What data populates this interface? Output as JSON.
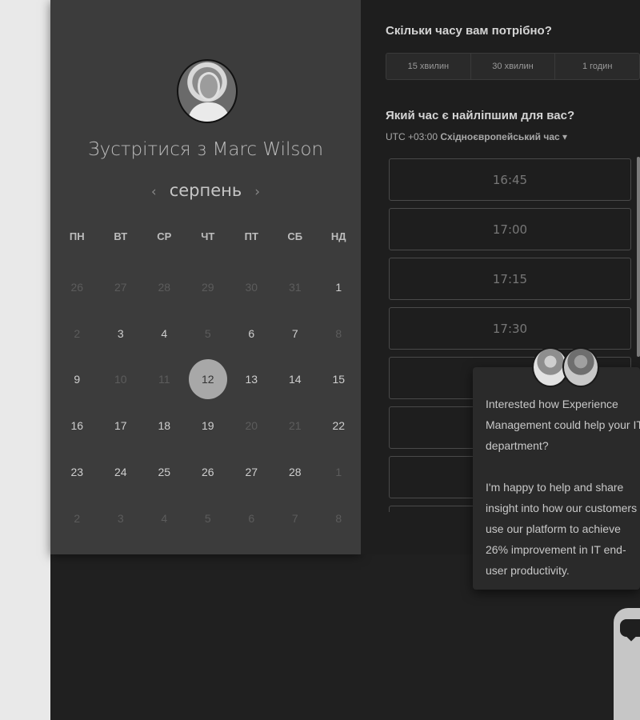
{
  "booking": {
    "title": "Зустрітися з Marc Wilson",
    "month": "серпень",
    "prev_icon": "‹",
    "next_icon": "›",
    "weekdays": [
      "ПН",
      "ВТ",
      "СР",
      "ЧТ",
      "ПТ",
      "СБ",
      "НД"
    ],
    "days": [
      {
        "d": "26",
        "s": "muted"
      },
      {
        "d": "27",
        "s": "muted"
      },
      {
        "d": "28",
        "s": "muted"
      },
      {
        "d": "29",
        "s": "muted"
      },
      {
        "d": "30",
        "s": "muted"
      },
      {
        "d": "31",
        "s": "muted"
      },
      {
        "d": "1",
        "s": "available"
      },
      {
        "d": "2",
        "s": "muted"
      },
      {
        "d": "3",
        "s": "available"
      },
      {
        "d": "4",
        "s": "available"
      },
      {
        "d": "5",
        "s": "muted"
      },
      {
        "d": "6",
        "s": "available"
      },
      {
        "d": "7",
        "s": "available"
      },
      {
        "d": "8",
        "s": "muted"
      },
      {
        "d": "9",
        "s": "available"
      },
      {
        "d": "10",
        "s": "muted"
      },
      {
        "d": "11",
        "s": "muted"
      },
      {
        "d": "12",
        "s": "selected"
      },
      {
        "d": "13",
        "s": "available"
      },
      {
        "d": "14",
        "s": "available"
      },
      {
        "d": "15",
        "s": "available"
      },
      {
        "d": "16",
        "s": "available"
      },
      {
        "d": "17",
        "s": "available"
      },
      {
        "d": "18",
        "s": "available"
      },
      {
        "d": "19",
        "s": "available"
      },
      {
        "d": "20",
        "s": "muted"
      },
      {
        "d": "21",
        "s": "muted"
      },
      {
        "d": "22",
        "s": "available"
      },
      {
        "d": "23",
        "s": "available"
      },
      {
        "d": "24",
        "s": "available"
      },
      {
        "d": "25",
        "s": "available"
      },
      {
        "d": "26",
        "s": "available"
      },
      {
        "d": "27",
        "s": "available"
      },
      {
        "d": "28",
        "s": "available"
      },
      {
        "d": "1",
        "s": "muted"
      },
      {
        "d": "2",
        "s": "muted"
      },
      {
        "d": "3",
        "s": "muted"
      },
      {
        "d": "4",
        "s": "muted"
      },
      {
        "d": "5",
        "s": "muted"
      },
      {
        "d": "6",
        "s": "muted"
      },
      {
        "d": "7",
        "s": "muted"
      },
      {
        "d": "8",
        "s": "muted"
      }
    ]
  },
  "duration": {
    "title": "Скільки часу вам потрібно?",
    "options": [
      "15 хвилин",
      "30 хвилин",
      "1 годин"
    ]
  },
  "time": {
    "title": "Який час є найліпшим для вас?",
    "timezone_prefix": "UTC +03:00",
    "timezone_name": "Східноєвропейський час",
    "dropdown_icon": "▾",
    "slots": [
      "16:45",
      "17:00",
      "17:15",
      "17:30",
      "",
      "",
      "",
      ""
    ]
  },
  "chat": {
    "message_1": "Interested how Experience Management could help your IT department?",
    "message_2": "I'm happy to help and share insight into how our customers use our platform to achieve 26% improvement in IT end-user productivity."
  }
}
